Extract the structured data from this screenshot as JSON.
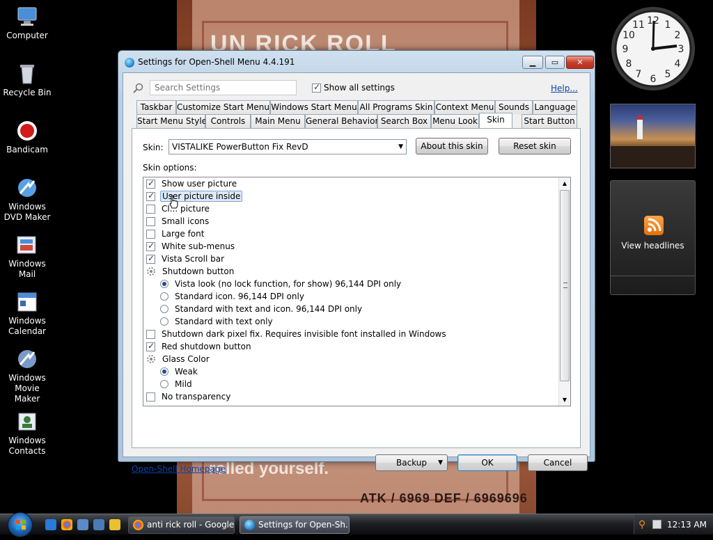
{
  "desktop": {
    "icons": [
      {
        "label": "Computer"
      },
      {
        "label": "Recycle Bin"
      },
      {
        "label": "Bandicam"
      },
      {
        "label": "Windows DVD Maker"
      },
      {
        "label": "Windows Mail"
      },
      {
        "label": "Windows Calendar"
      },
      {
        "label": "Windows Movie Maker"
      },
      {
        "label": "Windows Contacts"
      }
    ]
  },
  "video": {
    "title": "UN RICK ROLL",
    "bottom_text": "rolled yourself.",
    "stats": "ATK / 6969 DEF / 6969696"
  },
  "gadgets": {
    "feed_label": "View headlines"
  },
  "window": {
    "title": "Settings for Open-Shell Menu 4.4.191",
    "search_placeholder": "Search Settings",
    "show_all_label": "Show all settings",
    "show_all_checked": true,
    "help_label": "Help...",
    "tabs_row1": [
      "Taskbar",
      "Customize Start Menu",
      "Windows Start Menu",
      "All Programs Skin",
      "Context Menu",
      "Sounds",
      "Language"
    ],
    "tabs_row2": [
      "Start Menu Style",
      "Controls",
      "Main Menu",
      "General Behavior",
      "Search Box",
      "Menu Look",
      "Skin",
      "Start Button"
    ],
    "active_tab": "Skin",
    "skin_label": "Skin:",
    "skin_value": "VISTALIKE PowerButton Fix RevD",
    "about_skin_label": "About this skin",
    "reset_skin_label": "Reset skin",
    "skin_options_label": "Skin options:",
    "options": [
      {
        "label": "Show user picture",
        "kind": "check",
        "checked": true
      },
      {
        "label": "User picture inside",
        "kind": "check",
        "checked": true,
        "selected": true
      },
      {
        "label": "Cl... picture",
        "kind": "check",
        "checked": false
      },
      {
        "label": "Small icons",
        "kind": "check",
        "checked": false
      },
      {
        "label": "Large font",
        "kind": "check",
        "checked": false
      },
      {
        "label": "White sub-menus",
        "kind": "check",
        "checked": true
      },
      {
        "label": "Vista Scroll bar",
        "kind": "check",
        "checked": true
      },
      {
        "label": "Shutdown button",
        "kind": "group"
      },
      {
        "label": "Vista look (no lock function, for show) 96,144 DPI only",
        "kind": "radio",
        "checked": true
      },
      {
        "label": "Standard icon. 96,144 DPI only",
        "kind": "radio",
        "checked": false
      },
      {
        "label": "Standard with text and icon. 96,144 DPI only",
        "kind": "radio",
        "checked": false
      },
      {
        "label": "Standard with text only",
        "kind": "radio",
        "checked": false
      },
      {
        "label": "Shutdown dark pixel fix. Requires invisible font installed in Windows",
        "kind": "check",
        "checked": false
      },
      {
        "label": "Red shutdown button",
        "kind": "check",
        "checked": true
      },
      {
        "label": "Glass Color",
        "kind": "group"
      },
      {
        "label": "Weak",
        "kind": "radio",
        "checked": true
      },
      {
        "label": "Mild",
        "kind": "radio",
        "checked": false
      },
      {
        "label": "No transparency",
        "kind": "check",
        "checked": false
      }
    ],
    "homepage_label": "Open-Shell Homepage",
    "backup_label": "Backup",
    "ok_label": "OK",
    "cancel_label": "Cancel"
  },
  "taskbar": {
    "tasks": [
      {
        "label": "anti rick roll - Google..."
      },
      {
        "label": "Settings for Open-Sh..."
      }
    ],
    "clock": "12:13 AM"
  },
  "colors": {
    "link": "#0645ad",
    "selection": "#dce9f7",
    "close_button": "#c8402c"
  }
}
